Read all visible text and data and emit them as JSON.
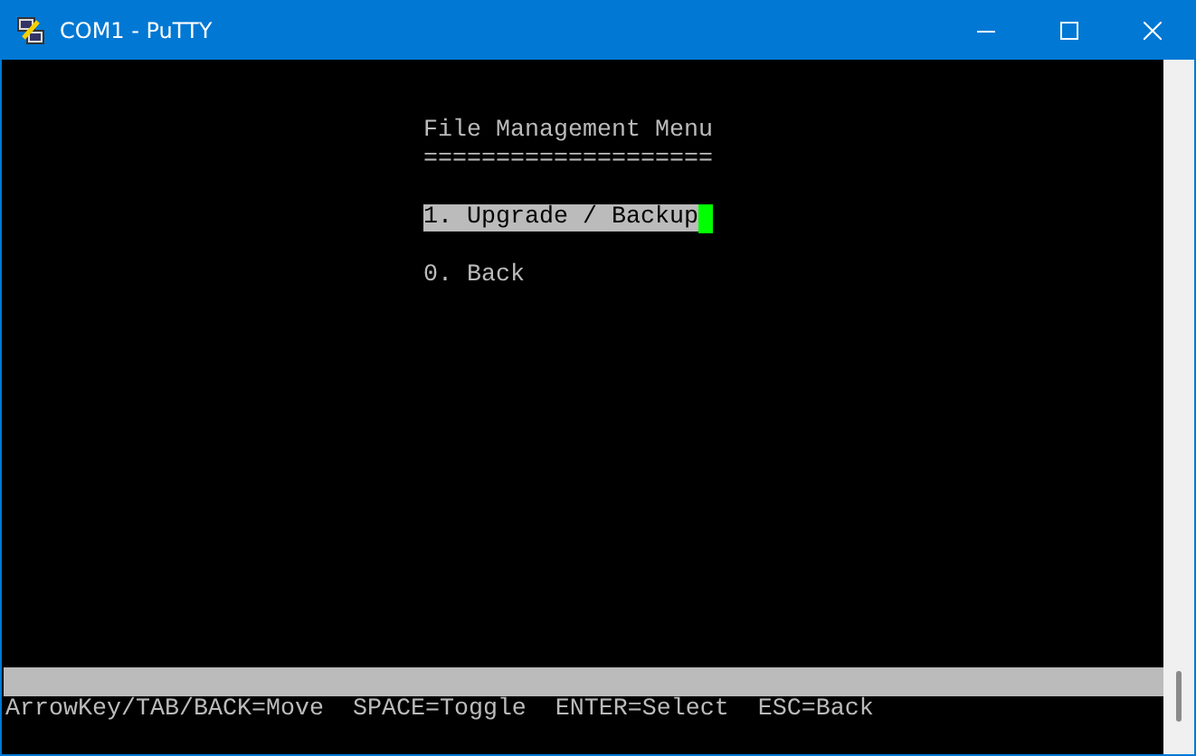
{
  "window": {
    "title": "COM1 - PuTTY"
  },
  "menu": {
    "title": "File Management Menu",
    "underline": "====================",
    "items": [
      {
        "label": "1. Upgrade / Backup",
        "selected": true
      },
      {
        "label": "0. Back",
        "selected": false
      }
    ]
  },
  "status_bar": {
    "text": "ArrowKey/TAB/BACK=Move  SPACE=Toggle  ENTER=Select  ESC=Back"
  }
}
